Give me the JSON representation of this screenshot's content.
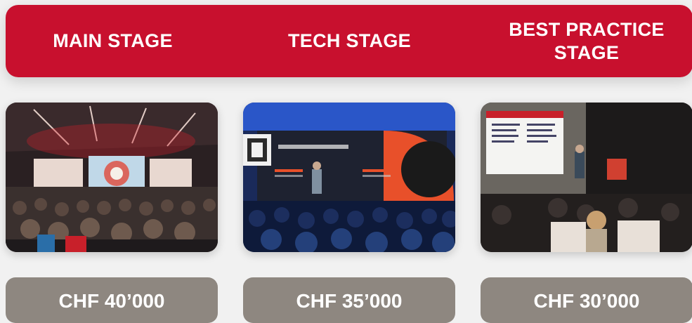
{
  "stages": [
    {
      "title": "MAIN STAGE",
      "price": "CHF 40’000"
    },
    {
      "title": "TECH STAGE",
      "price": "CHF 35’000"
    },
    {
      "title": "BEST PRACTICE STAGE",
      "price": "CHF 30’000"
    }
  ],
  "colors": {
    "header_red": "#c8102e",
    "price_grey": "#8e8780",
    "background": "#f1f1f1"
  }
}
